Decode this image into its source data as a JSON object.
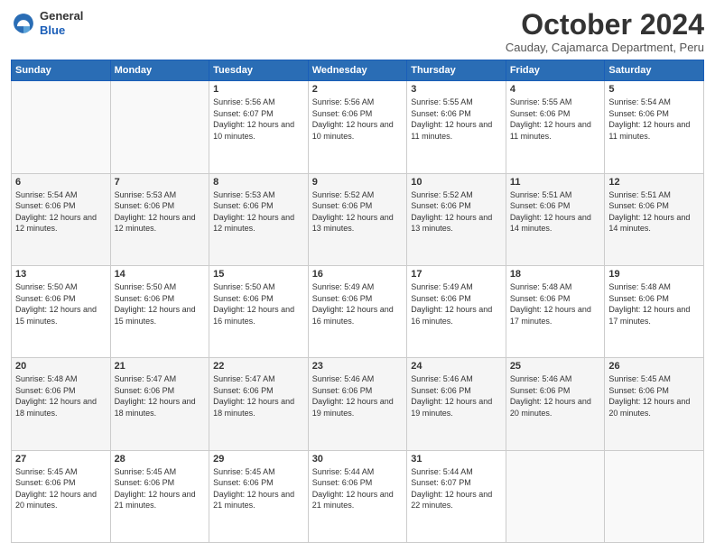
{
  "logo": {
    "general": "General",
    "blue": "Blue"
  },
  "header": {
    "month": "October 2024",
    "location": "Cauday, Cajamarca Department, Peru"
  },
  "days_header": [
    "Sunday",
    "Monday",
    "Tuesday",
    "Wednesday",
    "Thursday",
    "Friday",
    "Saturday"
  ],
  "weeks": [
    [
      {
        "day": "",
        "sunrise": "",
        "sunset": "",
        "daylight": ""
      },
      {
        "day": "",
        "sunrise": "",
        "sunset": "",
        "daylight": ""
      },
      {
        "day": "1",
        "sunrise": "Sunrise: 5:56 AM",
        "sunset": "Sunset: 6:07 PM",
        "daylight": "Daylight: 12 hours and 10 minutes."
      },
      {
        "day": "2",
        "sunrise": "Sunrise: 5:56 AM",
        "sunset": "Sunset: 6:06 PM",
        "daylight": "Daylight: 12 hours and 10 minutes."
      },
      {
        "day": "3",
        "sunrise": "Sunrise: 5:55 AM",
        "sunset": "Sunset: 6:06 PM",
        "daylight": "Daylight: 12 hours and 11 minutes."
      },
      {
        "day": "4",
        "sunrise": "Sunrise: 5:55 AM",
        "sunset": "Sunset: 6:06 PM",
        "daylight": "Daylight: 12 hours and 11 minutes."
      },
      {
        "day": "5",
        "sunrise": "Sunrise: 5:54 AM",
        "sunset": "Sunset: 6:06 PM",
        "daylight": "Daylight: 12 hours and 11 minutes."
      }
    ],
    [
      {
        "day": "6",
        "sunrise": "Sunrise: 5:54 AM",
        "sunset": "Sunset: 6:06 PM",
        "daylight": "Daylight: 12 hours and 12 minutes."
      },
      {
        "day": "7",
        "sunrise": "Sunrise: 5:53 AM",
        "sunset": "Sunset: 6:06 PM",
        "daylight": "Daylight: 12 hours and 12 minutes."
      },
      {
        "day": "8",
        "sunrise": "Sunrise: 5:53 AM",
        "sunset": "Sunset: 6:06 PM",
        "daylight": "Daylight: 12 hours and 12 minutes."
      },
      {
        "day": "9",
        "sunrise": "Sunrise: 5:52 AM",
        "sunset": "Sunset: 6:06 PM",
        "daylight": "Daylight: 12 hours and 13 minutes."
      },
      {
        "day": "10",
        "sunrise": "Sunrise: 5:52 AM",
        "sunset": "Sunset: 6:06 PM",
        "daylight": "Daylight: 12 hours and 13 minutes."
      },
      {
        "day": "11",
        "sunrise": "Sunrise: 5:51 AM",
        "sunset": "Sunset: 6:06 PM",
        "daylight": "Daylight: 12 hours and 14 minutes."
      },
      {
        "day": "12",
        "sunrise": "Sunrise: 5:51 AM",
        "sunset": "Sunset: 6:06 PM",
        "daylight": "Daylight: 12 hours and 14 minutes."
      }
    ],
    [
      {
        "day": "13",
        "sunrise": "Sunrise: 5:50 AM",
        "sunset": "Sunset: 6:06 PM",
        "daylight": "Daylight: 12 hours and 15 minutes."
      },
      {
        "day": "14",
        "sunrise": "Sunrise: 5:50 AM",
        "sunset": "Sunset: 6:06 PM",
        "daylight": "Daylight: 12 hours and 15 minutes."
      },
      {
        "day": "15",
        "sunrise": "Sunrise: 5:50 AM",
        "sunset": "Sunset: 6:06 PM",
        "daylight": "Daylight: 12 hours and 16 minutes."
      },
      {
        "day": "16",
        "sunrise": "Sunrise: 5:49 AM",
        "sunset": "Sunset: 6:06 PM",
        "daylight": "Daylight: 12 hours and 16 minutes."
      },
      {
        "day": "17",
        "sunrise": "Sunrise: 5:49 AM",
        "sunset": "Sunset: 6:06 PM",
        "daylight": "Daylight: 12 hours and 16 minutes."
      },
      {
        "day": "18",
        "sunrise": "Sunrise: 5:48 AM",
        "sunset": "Sunset: 6:06 PM",
        "daylight": "Daylight: 12 hours and 17 minutes."
      },
      {
        "day": "19",
        "sunrise": "Sunrise: 5:48 AM",
        "sunset": "Sunset: 6:06 PM",
        "daylight": "Daylight: 12 hours and 17 minutes."
      }
    ],
    [
      {
        "day": "20",
        "sunrise": "Sunrise: 5:48 AM",
        "sunset": "Sunset: 6:06 PM",
        "daylight": "Daylight: 12 hours and 18 minutes."
      },
      {
        "day": "21",
        "sunrise": "Sunrise: 5:47 AM",
        "sunset": "Sunset: 6:06 PM",
        "daylight": "Daylight: 12 hours and 18 minutes."
      },
      {
        "day": "22",
        "sunrise": "Sunrise: 5:47 AM",
        "sunset": "Sunset: 6:06 PM",
        "daylight": "Daylight: 12 hours and 18 minutes."
      },
      {
        "day": "23",
        "sunrise": "Sunrise: 5:46 AM",
        "sunset": "Sunset: 6:06 PM",
        "daylight": "Daylight: 12 hours and 19 minutes."
      },
      {
        "day": "24",
        "sunrise": "Sunrise: 5:46 AM",
        "sunset": "Sunset: 6:06 PM",
        "daylight": "Daylight: 12 hours and 19 minutes."
      },
      {
        "day": "25",
        "sunrise": "Sunrise: 5:46 AM",
        "sunset": "Sunset: 6:06 PM",
        "daylight": "Daylight: 12 hours and 20 minutes."
      },
      {
        "day": "26",
        "sunrise": "Sunrise: 5:45 AM",
        "sunset": "Sunset: 6:06 PM",
        "daylight": "Daylight: 12 hours and 20 minutes."
      }
    ],
    [
      {
        "day": "27",
        "sunrise": "Sunrise: 5:45 AM",
        "sunset": "Sunset: 6:06 PM",
        "daylight": "Daylight: 12 hours and 20 minutes."
      },
      {
        "day": "28",
        "sunrise": "Sunrise: 5:45 AM",
        "sunset": "Sunset: 6:06 PM",
        "daylight": "Daylight: 12 hours and 21 minutes."
      },
      {
        "day": "29",
        "sunrise": "Sunrise: 5:45 AM",
        "sunset": "Sunset: 6:06 PM",
        "daylight": "Daylight: 12 hours and 21 minutes."
      },
      {
        "day": "30",
        "sunrise": "Sunrise: 5:44 AM",
        "sunset": "Sunset: 6:06 PM",
        "daylight": "Daylight: 12 hours and 21 minutes."
      },
      {
        "day": "31",
        "sunrise": "Sunrise: 5:44 AM",
        "sunset": "Sunset: 6:07 PM",
        "daylight": "Daylight: 12 hours and 22 minutes."
      },
      {
        "day": "",
        "sunrise": "",
        "sunset": "",
        "daylight": ""
      },
      {
        "day": "",
        "sunrise": "",
        "sunset": "",
        "daylight": ""
      }
    ]
  ]
}
